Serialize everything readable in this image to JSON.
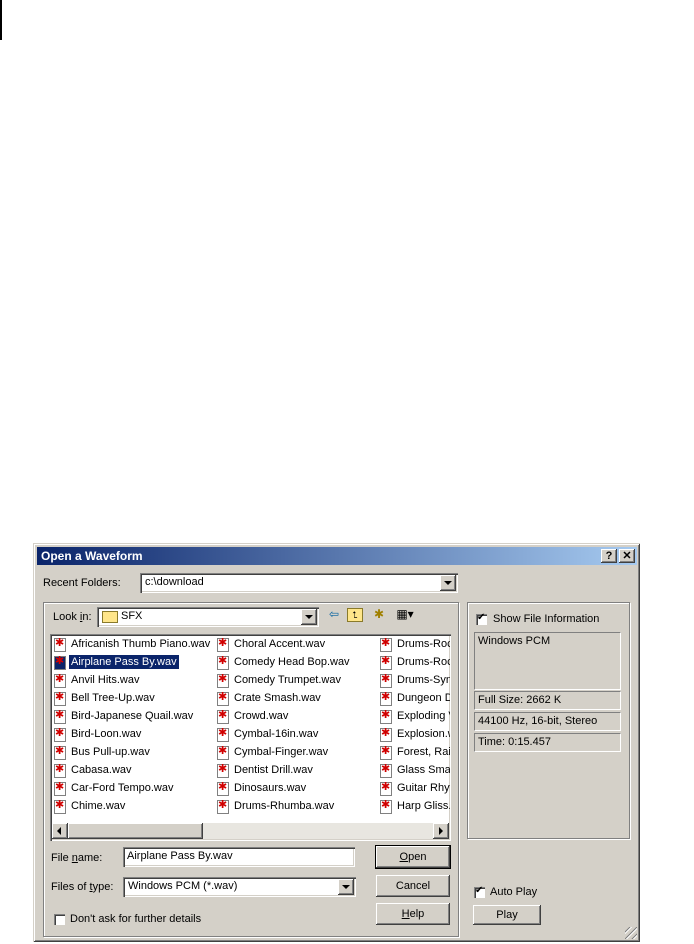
{
  "window": {
    "title": "Open a Waveform",
    "help_glyph": "?",
    "close_glyph": "✕"
  },
  "recent": {
    "label": "Recent Folders:",
    "value": "c:\\download"
  },
  "lookin": {
    "label_pre": "Look ",
    "label_u": "i",
    "label_post": "n:",
    "value": "SFX"
  },
  "toolbar": {
    "back_glyph": "⇦",
    "up_glyph": "⮤",
    "newfolder_glyph": "✱",
    "view_glyph": "▦▾"
  },
  "files": {
    "col1": [
      "Africanish Thumb Piano.wav",
      "Airplane Pass By.wav",
      "Anvil Hits.wav",
      "Bell Tree-Up.wav",
      "Bird-Japanese Quail.wav",
      "Bird-Loon.wav",
      "Bus Pull-up.wav",
      "Cabasa.wav",
      "Car-Ford Tempo.wav",
      "Chime.wav"
    ],
    "col2": [
      "Choral Accent.wav",
      "Comedy Head Bop.wav",
      "Comedy Trumpet.wav",
      "Crate Smash.wav",
      "Crowd.wav",
      "Cymbal-16in.wav",
      "Cymbal-Finger.wav",
      "Dentist Drill.wav",
      "Dinosaurs.wav",
      "Drums-Rhumba.wav"
    ],
    "col3": [
      "Drums-Rock",
      "Drums-Rock",
      "Drums-Sync",
      "Dungeon D",
      "Exploding V",
      "Explosion.w",
      "Forest, Rain",
      "Glass Smas",
      "Guitar Rhyth",
      "Harp Gliss.w"
    ],
    "selected": "Airplane Pass By.wav"
  },
  "filename": {
    "label_pre": "File ",
    "label_u": "n",
    "label_post": "ame:",
    "value": "Airplane Pass By.wav"
  },
  "filetype": {
    "label_pre": "Files of ",
    "label_u": "t",
    "label_post": "ype:",
    "value": "Windows PCM (*.wav)"
  },
  "dont_ask": {
    "label": "Don't ask for further details",
    "checked": false
  },
  "buttons": {
    "open_u": "O",
    "open_rest": "pen",
    "cancel": "Cancel",
    "help_u": "H",
    "help_rest": "elp",
    "play": "Play"
  },
  "info": {
    "show_label": "Show File Information",
    "show_checked": true,
    "format": "Windows PCM",
    "full_size": "Full Size: 2662 K",
    "specs": "44100 Hz, 16-bit, Stereo",
    "time": "Time:   0:15.457"
  },
  "autoplay": {
    "label": "Auto Play",
    "checked": true
  }
}
